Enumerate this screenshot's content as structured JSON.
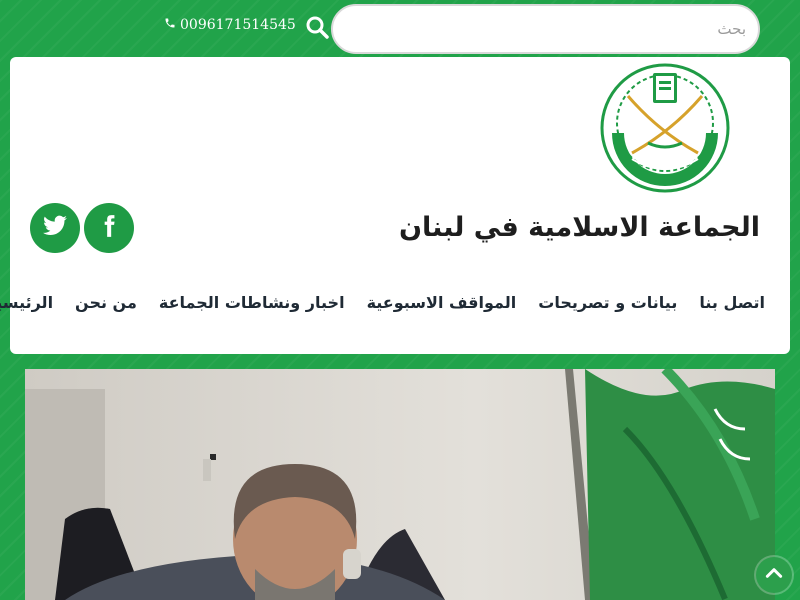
{
  "search": {
    "placeholder": "بحث",
    "value": ""
  },
  "contact": {
    "phone": "0096171514545"
  },
  "site": {
    "title": "الجماعة الاسلامية في لبنان"
  },
  "social": {
    "twitter": "twitter",
    "facebook": "facebook"
  },
  "nav": {
    "items": [
      {
        "label": "الرئيسية"
      },
      {
        "label": "من نحن"
      },
      {
        "label": "اخبار ونشاطات الجماعة"
      },
      {
        "label": "المواقف الاسبوعية"
      },
      {
        "label": "بيانات و تصريحات"
      },
      {
        "label": "اتصل بنا"
      }
    ]
  },
  "colors": {
    "brand_green": "#21a34a",
    "dark_green": "#1f9b45",
    "text": "#1e1e1e"
  },
  "icons": [
    "search-icon",
    "phone-icon",
    "twitter-icon",
    "facebook-icon",
    "chevron-up-icon"
  ]
}
